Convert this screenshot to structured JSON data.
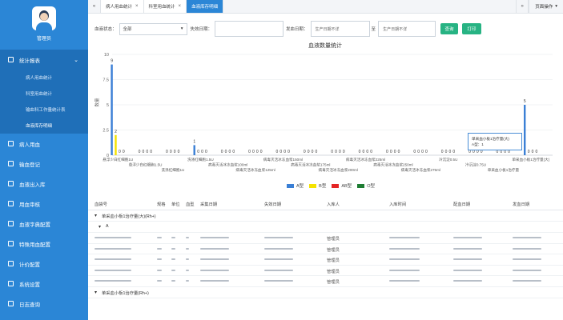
{
  "sidebar": {
    "username": "管理员",
    "menu": [
      {
        "label": "统计报表",
        "icon": "chart-icon",
        "expanded": true
      },
      {
        "label": "病人用血",
        "icon": "user-icon"
      },
      {
        "label": "输血登记",
        "icon": "form-icon"
      },
      {
        "label": "血液出入库",
        "icon": "box-icon"
      },
      {
        "label": "用血审核",
        "icon": "check-icon"
      },
      {
        "label": "血液字典配置",
        "icon": "book-icon"
      },
      {
        "label": "特殊用血配置",
        "icon": "star-icon"
      },
      {
        "label": "计价配置",
        "icon": "price-icon"
      },
      {
        "label": "系统设置",
        "icon": "gear-icon"
      },
      {
        "label": "日志查询",
        "icon": "log-icon"
      }
    ],
    "submenu": [
      "病人用血统计",
      "科室用血统计",
      "输血科工作量统计表",
      "血液库存明细"
    ]
  },
  "tabs": {
    "items": [
      {
        "label": "病人用血统计",
        "active": false
      },
      {
        "label": "科室用血统计",
        "active": false
      },
      {
        "label": "血液库存明细",
        "active": true
      }
    ],
    "ops_label": "页面操作"
  },
  "filter": {
    "status_label": "血液状态：",
    "status_value": "全部",
    "expire_label": "失效日期：",
    "expire_value": "",
    "dispense_label": "发血日期：",
    "date_from": "生产日期不详",
    "to_label": "至",
    "date_to": "生产日期不详",
    "query_button": "查询",
    "print_button": "打印"
  },
  "chart_data": {
    "type": "bar",
    "title": "血液数量统计",
    "ylabel": "数量",
    "ylim": [
      0,
      10
    ],
    "yticks": [
      "0",
      "2.5",
      "5",
      "7.5",
      "10"
    ],
    "colors": {
      "A型": "#3a7fd5",
      "B型": "#f5e300",
      "AB型": "#e42525",
      "O型": "#1e7d33"
    },
    "categories": [
      "悬浮少白红细胞1U",
      "悬浮少白红细胞1.5U",
      "洗涤红细胞1U",
      "洗涤红细胞1.5U",
      "病毒灭活冰冻血浆100ml",
      "病毒灭活冰冻血浆125ml",
      "病毒灭活冰冻血浆150ml",
      "病毒灭活冰冻血浆175ml",
      "病毒灭活冰冻血浆200ml",
      "病毒灭活冰冻血浆225ml",
      "病毒灭活冰冻血浆250ml",
      "病毒灭活冰冻血浆275ml",
      "冷沉淀0.5U",
      "冷沉淀0.75U",
      "单采血小板1治疗量",
      "单采血小板1治疗量(大)"
    ],
    "series": [
      {
        "name": "A型",
        "values": [
          9,
          0,
          0,
          1,
          0,
          0,
          0,
          0,
          0,
          0,
          0,
          0,
          0,
          0,
          0,
          5
        ]
      },
      {
        "name": "B型",
        "values": [
          2,
          0,
          0,
          0,
          0,
          0,
          0,
          0,
          0,
          0,
          0,
          0,
          0,
          0,
          0,
          0
        ]
      },
      {
        "name": "AB型",
        "values": [
          0,
          0,
          0,
          0,
          0,
          0,
          0,
          0,
          0,
          0,
          0,
          0,
          0,
          0,
          0,
          0
        ]
      },
      {
        "name": "O型",
        "values": [
          0,
          0,
          0,
          0,
          0,
          0,
          0,
          0,
          0,
          0,
          0,
          0,
          0,
          0,
          0,
          0
        ]
      }
    ],
    "legend": [
      "A型",
      "B型",
      "AB型",
      "O型"
    ],
    "legend_position": "bottom"
  },
  "tooltip": {
    "title": "单采血小板1治疗量(大)",
    "line": "A型：1"
  },
  "table": {
    "headers": [
      "血袋号",
      "规格",
      "单位",
      "血型",
      "采集日期",
      "失效日期",
      "入库人",
      "入库时间",
      "配血日期",
      "发血日期"
    ],
    "groups": [
      {
        "label": "单采血小板1治疗量(大)(Rh+)",
        "subgroup": "A",
        "rows": [
          {
            "bag": "",
            "spec": "",
            "unit": "",
            "type": "",
            "collect": "",
            "expire": "",
            "user": "管理员",
            "in_time": "",
            "match": "",
            "dispense": ""
          },
          {
            "bag": "",
            "spec": "",
            "unit": "",
            "type": "",
            "collect": "",
            "expire": "",
            "user": "管理员",
            "in_time": "",
            "match": "",
            "dispense": ""
          },
          {
            "bag": "",
            "spec": "",
            "unit": "",
            "type": "",
            "collect": "",
            "expire": "",
            "user": "管理员",
            "in_time": "",
            "match": "",
            "dispense": ""
          },
          {
            "bag": "",
            "spec": "",
            "unit": "",
            "type": "",
            "collect": "",
            "expire": "",
            "user": "管理员",
            "in_time": "",
            "match": "",
            "dispense": ""
          },
          {
            "bag": "",
            "spec": "",
            "unit": "",
            "type": "",
            "collect": "",
            "expire": "",
            "user": "管理员",
            "in_time": "",
            "match": "",
            "dispense": ""
          }
        ]
      },
      {
        "label": "单采血小板1治疗量(Rh+)",
        "subgroup": "",
        "rows": []
      }
    ]
  }
}
